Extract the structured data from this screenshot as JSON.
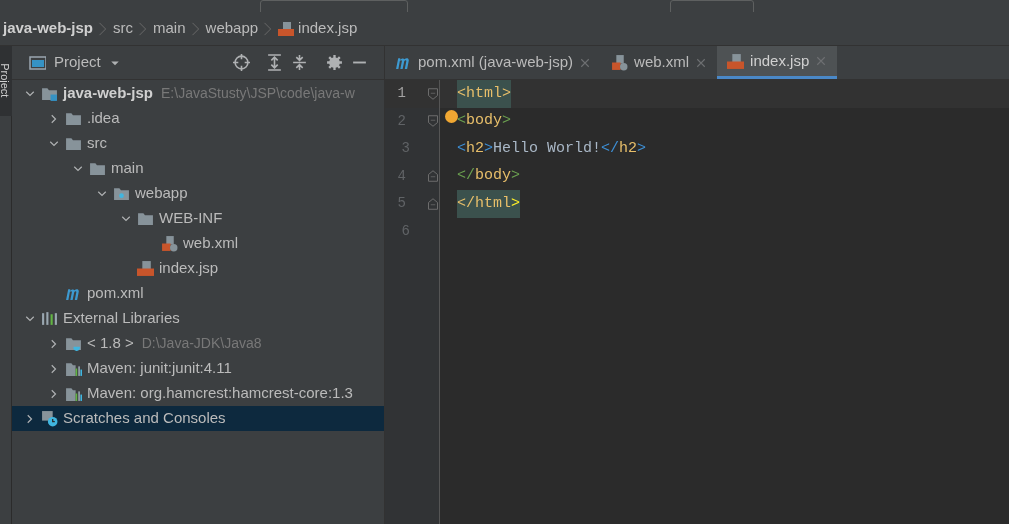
{
  "breadcrumbs": [
    {
      "label": "java-web-jsp",
      "kind": "plain"
    },
    {
      "label": "src",
      "kind": "plain"
    },
    {
      "label": "main",
      "kind": "plain"
    },
    {
      "label": "webapp",
      "kind": "plain"
    },
    {
      "label": "index.jsp",
      "kind": "jsp"
    }
  ],
  "side_tab": "Project",
  "project_panel": {
    "title": "Project",
    "tree": [
      {
        "label": "java-web-jsp",
        "hint": "E:\\JavaStusty\\JSP\\code\\java-w",
        "kind": "module",
        "expanded": true,
        "selected": false,
        "children": [
          {
            "label": ".idea",
            "kind": "folder",
            "expanded": false,
            "selected": false
          },
          {
            "label": "src",
            "kind": "folder",
            "expanded": true,
            "selected": false,
            "children": [
              {
                "label": "main",
                "kind": "folder",
                "expanded": true,
                "selected": false,
                "children": [
                  {
                    "label": "webapp",
                    "kind": "webfolder",
                    "expanded": true,
                    "selected": false,
                    "children": [
                      {
                        "label": "WEB-INF",
                        "kind": "folder",
                        "expanded": true,
                        "selected": false,
                        "children": [
                          {
                            "label": "web.xml",
                            "kind": "xml",
                            "selected": false
                          }
                        ]
                      },
                      {
                        "label": "index.jsp",
                        "kind": "jsp",
                        "selected": false
                      }
                    ]
                  }
                ]
              }
            ]
          },
          {
            "label": "pom.xml",
            "kind": "maven",
            "selected": false
          }
        ]
      },
      {
        "label": "External Libraries",
        "kind": "libraries",
        "expanded": true,
        "selected": false,
        "children": [
          {
            "label": "< 1.8 >",
            "hint": "D:\\Java-JDK\\Java8",
            "kind": "jdk",
            "expanded": false,
            "selected": false
          },
          {
            "label": "Maven: junit:junit:4.11",
            "kind": "library",
            "expanded": false,
            "selected": false
          },
          {
            "label": "Maven: org.hamcrest:hamcrest-core:1.3",
            "kind": "library",
            "expanded": false,
            "selected": false
          }
        ]
      },
      {
        "label": "Scratches and Consoles",
        "kind": "scratches",
        "expanded": false,
        "selected": true
      }
    ]
  },
  "tabs": [
    {
      "label": "pom.xml (java-web-jsp)",
      "kind": "maven",
      "selected": false
    },
    {
      "label": "web.xml",
      "kind": "xml",
      "selected": false
    },
    {
      "label": "index.jsp",
      "kind": "jsp",
      "selected": true
    }
  ],
  "editor": {
    "lines": [
      {
        "number": "1",
        "kind": "foldstart",
        "tokens": [
          {
            "text": "<",
            "color": "#e8bf6a",
            "matched": true
          },
          {
            "text": "html>",
            "color": "#e8bf6a",
            "matched": true
          }
        ]
      },
      {
        "number": "2",
        "kind": "foldstart",
        "tokens": [
          {
            "text": "<",
            "color": "#6a9f4f",
            "matched": false
          },
          {
            "text": "body",
            "color": "#e8bf6a",
            "matched": false
          },
          {
            "text": ">",
            "color": "#6a9f4f",
            "matched": false
          }
        ]
      },
      {
        "number": "3",
        "kind": "plain",
        "tokens": [
          {
            "text": "<",
            "color": "#3d8fd6",
            "matched": false
          },
          {
            "text": "h2",
            "color": "#e8bf6a",
            "matched": false
          },
          {
            "text": ">",
            "color": "#3d8fd6",
            "matched": false
          },
          {
            "text": "Hello World!",
            "color": "#a9b7c6",
            "matched": false
          },
          {
            "text": "</",
            "color": "#3d8fd6",
            "matched": false
          },
          {
            "text": "h2",
            "color": "#e8bf6a",
            "matched": false
          },
          {
            "text": ">",
            "color": "#3d8fd6",
            "matched": false
          }
        ]
      },
      {
        "number": "4",
        "kind": "foldend",
        "tokens": [
          {
            "text": "</",
            "color": "#6a9f4f",
            "matched": false
          },
          {
            "text": "body",
            "color": "#e8bf6a",
            "matched": false
          },
          {
            "text": ">",
            "color": "#6a9f4f",
            "matched": false
          }
        ]
      },
      {
        "number": "5",
        "kind": "foldend",
        "tokens": [
          {
            "text": "</html",
            "color": "#e8bf6a",
            "matched": true
          },
          {
            "text": ">",
            "color": "#ffef28",
            "matched": true
          }
        ]
      },
      {
        "number": "6",
        "kind": "plain"
      }
    ]
  }
}
